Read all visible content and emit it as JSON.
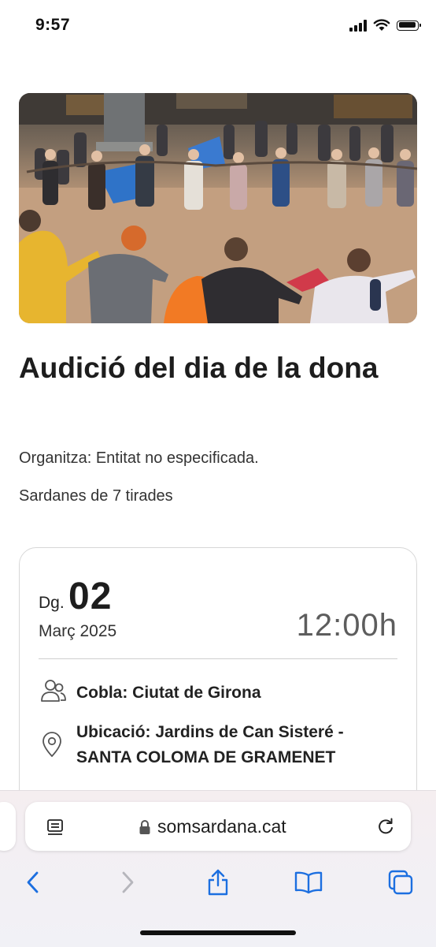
{
  "status_bar": {
    "time": "9:57",
    "icons": [
      "signal-icon",
      "wifi-icon",
      "battery-icon"
    ]
  },
  "event": {
    "image_alt": "Sardana dancers in a circle in a town square",
    "title": "Audició del dia de la dona",
    "organizer": "Organitza: Entitat no especificada.",
    "description": "Sardanes de 7 tirades"
  },
  "card": {
    "day_of_week": "Dg.",
    "day_number": "02",
    "month_year": "Març 2025",
    "time": "12:00h",
    "cobla": "Cobla: Ciutat de Girona",
    "location": "Ubicació: Jardins de Can Sisteré - SANTA COLOMA DE GRAMENET"
  },
  "browser": {
    "url": "somsardana.cat",
    "toolbar": [
      "back-icon",
      "forward-icon",
      "share-icon",
      "bookmarks-icon",
      "tabs-icon"
    ]
  },
  "colors": {
    "accent": "#1c6fe0",
    "disabled": "#b6b6bc",
    "text": "#1d1d1d"
  }
}
